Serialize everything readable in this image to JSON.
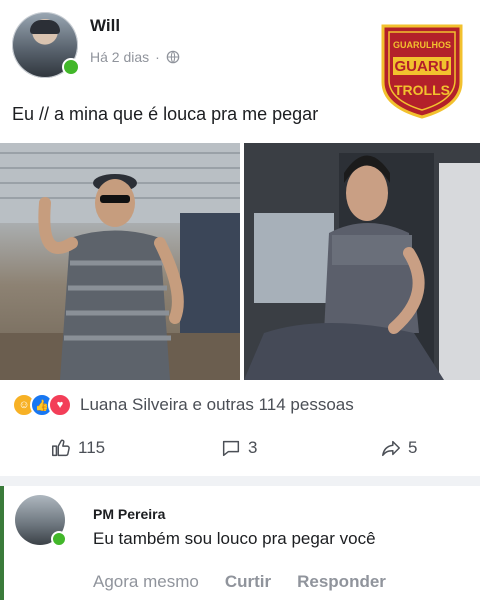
{
  "post": {
    "author": "Will",
    "time": "Há 2 dias",
    "separator": "·",
    "text": "Eu // a mina que é louca pra me pegar"
  },
  "logo": {
    "line1": "GUARULHOS",
    "line2": "GUARU",
    "line3": "TROLLS"
  },
  "reactions": {
    "summary": "Luana Silveira e outras 114 pessoas"
  },
  "actions": {
    "likes": "115",
    "comments": "3",
    "shares": "5"
  },
  "comment": {
    "author": "PM Pereira",
    "text": "Eu também sou louco pra pegar você",
    "time": "Agora mesmo",
    "like_label": "Curtir",
    "reply_label": "Responder"
  },
  "colors": {
    "online": "#42b72a",
    "logo_red": "#b3202a",
    "logo_gold": "#f2c12e"
  }
}
